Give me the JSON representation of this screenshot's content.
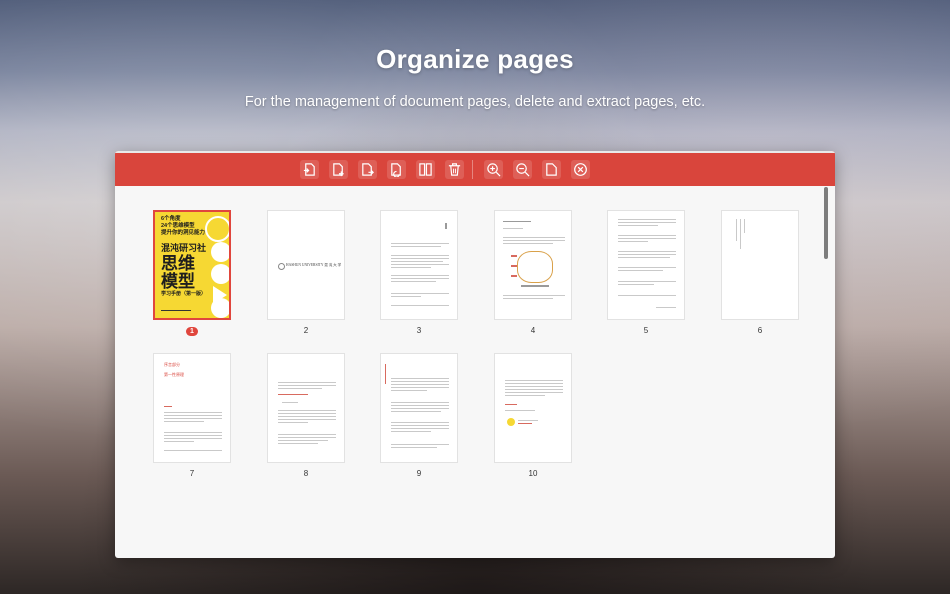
{
  "hero": {
    "title": "Organize pages",
    "subtitle": "For the management of document pages, delete and extract pages, etc."
  },
  "toolbar": {
    "buttons": [
      {
        "name": "insert-page-button",
        "icon": "insert-page-icon"
      },
      {
        "name": "add-page-button",
        "icon": "add-page-icon"
      },
      {
        "name": "replace-page-button",
        "icon": "replace-page-icon"
      },
      {
        "name": "rotate-page-button",
        "icon": "rotate-page-icon"
      },
      {
        "name": "split-page-button",
        "icon": "split-page-icon"
      },
      {
        "name": "delete-page-button",
        "icon": "trash-icon"
      },
      {
        "name": "zoom-in-button",
        "icon": "zoom-in-icon"
      },
      {
        "name": "zoom-out-button",
        "icon": "zoom-out-icon"
      },
      {
        "name": "single-page-button",
        "icon": "page-icon"
      },
      {
        "name": "close-button",
        "icon": "close-circle-icon"
      }
    ]
  },
  "pages": [
    {
      "number": "1",
      "selected": true
    },
    {
      "number": "2",
      "selected": false
    },
    {
      "number": "3",
      "selected": false
    },
    {
      "number": "4",
      "selected": false
    },
    {
      "number": "5",
      "selected": false
    },
    {
      "number": "6",
      "selected": false
    },
    {
      "number": "7",
      "selected": false
    },
    {
      "number": "8",
      "selected": false
    },
    {
      "number": "9",
      "selected": false
    },
    {
      "number": "10",
      "selected": false
    }
  ],
  "cover": {
    "line1": "6个角度",
    "line2": "24个思维模型",
    "line3": "提升你的洞见能力",
    "brand": "混沌研习社",
    "title": "思维模型",
    "subtitle": "学习手册（第一版）"
  },
  "page2": {
    "header": "HASHUN UNIVERSITY 混 沌 大 学"
  },
  "page7": {
    "heading1": "序言部分",
    "heading2": "第一性原理"
  },
  "colors": {
    "accent": "#d9453c",
    "cover_yellow": "#f6d833"
  }
}
